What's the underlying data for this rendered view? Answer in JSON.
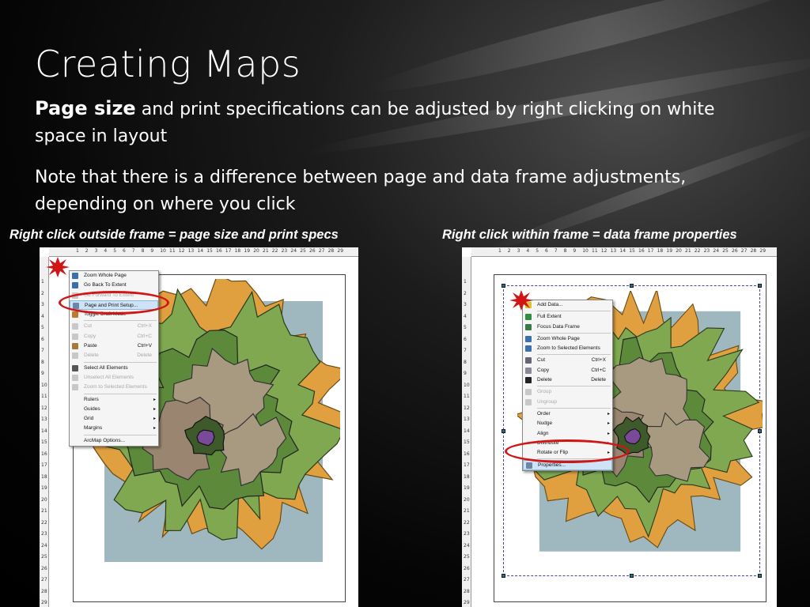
{
  "slide": {
    "title": "Creating Maps",
    "para1_bold": "Page size",
    "para1_rest": " and print specifications can be adjusted by right clicking on white space in layout",
    "para2": "Note that there is a difference between page and data frame adjustments, depending on where you click",
    "caption_left": "Right click outside frame = page size and print specs",
    "caption_right": "Right click within frame = data frame properties"
  },
  "ruler_ticks": [
    "1",
    "2",
    "3",
    "4",
    "5",
    "6",
    "7",
    "8",
    "9",
    "10",
    "11",
    "12",
    "13",
    "14",
    "15",
    "16",
    "17",
    "18",
    "19",
    "20",
    "21",
    "22",
    "23",
    "24",
    "25",
    "26",
    "27",
    "28",
    "29"
  ],
  "left_menu": [
    {
      "label": "Zoom Whole Page",
      "icon": "zoom-page-icon",
      "color": "#3c6fb0"
    },
    {
      "label": "Go Back To Extent",
      "icon": "back-extent-icon",
      "color": "#3c6fb0"
    },
    {
      "label": "Go Forward To Extent",
      "icon": "forward-extent-icon",
      "disabled": true
    },
    {
      "label": "Page and Print Setup...",
      "icon": "page-setup-icon",
      "highlight": true,
      "color": "#6b86a8"
    },
    {
      "label": "Toggle Draft Mode",
      "icon": "draft-mode-icon",
      "color": "#c07a30"
    },
    {
      "sep": true
    },
    {
      "label": "Cut",
      "shortcut": "Ctrl+X",
      "icon": "cut-icon",
      "disabled": true
    },
    {
      "label": "Copy",
      "shortcut": "Ctrl+C",
      "icon": "copy-icon",
      "disabled": true
    },
    {
      "label": "Paste",
      "shortcut": "Ctrl+V",
      "icon": "paste-icon",
      "color": "#a87a3a"
    },
    {
      "label": "Delete",
      "shortcut": "Delete",
      "icon": "delete-icon",
      "disabled": true
    },
    {
      "sep": true
    },
    {
      "label": "Select All Elements",
      "icon": "select-all-icon",
      "color": "#555"
    },
    {
      "label": "Unselect All Elements",
      "icon": "unselect-icon",
      "disabled": true
    },
    {
      "label": "Zoom to Selected Elements",
      "icon": "zoom-selected-icon",
      "disabled": true
    },
    {
      "sep": true
    },
    {
      "label": "Rulers",
      "arrow": "▸"
    },
    {
      "label": "Guides",
      "arrow": "▸"
    },
    {
      "label": "Grid",
      "arrow": "▸"
    },
    {
      "label": "Margins",
      "arrow": "▸"
    },
    {
      "sep": true
    },
    {
      "label": "ArcMap Options..."
    }
  ],
  "right_menu": [
    {
      "label": "Add Data...",
      "icon": "add-data-icon",
      "color": "#e0c030"
    },
    {
      "sep": true
    },
    {
      "label": "Full Extent",
      "icon": "globe-icon",
      "color": "#2f8f3f"
    },
    {
      "label": "Focus Data Frame",
      "icon": "focus-frame-icon",
      "color": "#3a7a4a"
    },
    {
      "sep": true
    },
    {
      "label": "Zoom Whole Page",
      "icon": "zoom-page-icon",
      "color": "#3c6fb0"
    },
    {
      "label": "Zoom to Selected Elements",
      "icon": "zoom-selected-icon",
      "color": "#3c6fb0"
    },
    {
      "sep": true
    },
    {
      "label": "Cut",
      "shortcut": "Ctrl+X",
      "icon": "cut-icon",
      "color": "#667"
    },
    {
      "label": "Copy",
      "shortcut": "Ctrl+C",
      "icon": "copy-icon",
      "color": "#889"
    },
    {
      "label": "Delete",
      "shortcut": "Delete",
      "icon": "delete-icon",
      "color": "#222"
    },
    {
      "sep": true
    },
    {
      "label": "Group",
      "icon": "group-icon",
      "disabled": true
    },
    {
      "label": "Ungroup",
      "icon": "ungroup-icon",
      "disabled": true
    },
    {
      "sep": true
    },
    {
      "label": "Order",
      "arrow": "▸"
    },
    {
      "label": "Nudge",
      "arrow": "▸"
    },
    {
      "label": "Align",
      "arrow": "▸"
    },
    {
      "label": "Distribute",
      "arrow": "▸"
    },
    {
      "label": "Rotate or Flip",
      "arrow": "▸"
    },
    {
      "sep": true
    },
    {
      "label": "Properties...",
      "icon": "properties-icon",
      "highlight": true,
      "color": "#6b86a8"
    }
  ],
  "colors": {
    "accent_red": "#d01515",
    "menu_highlight": "#cfe3f7",
    "water": "#9fb8c0",
    "land": "#7fa850"
  }
}
